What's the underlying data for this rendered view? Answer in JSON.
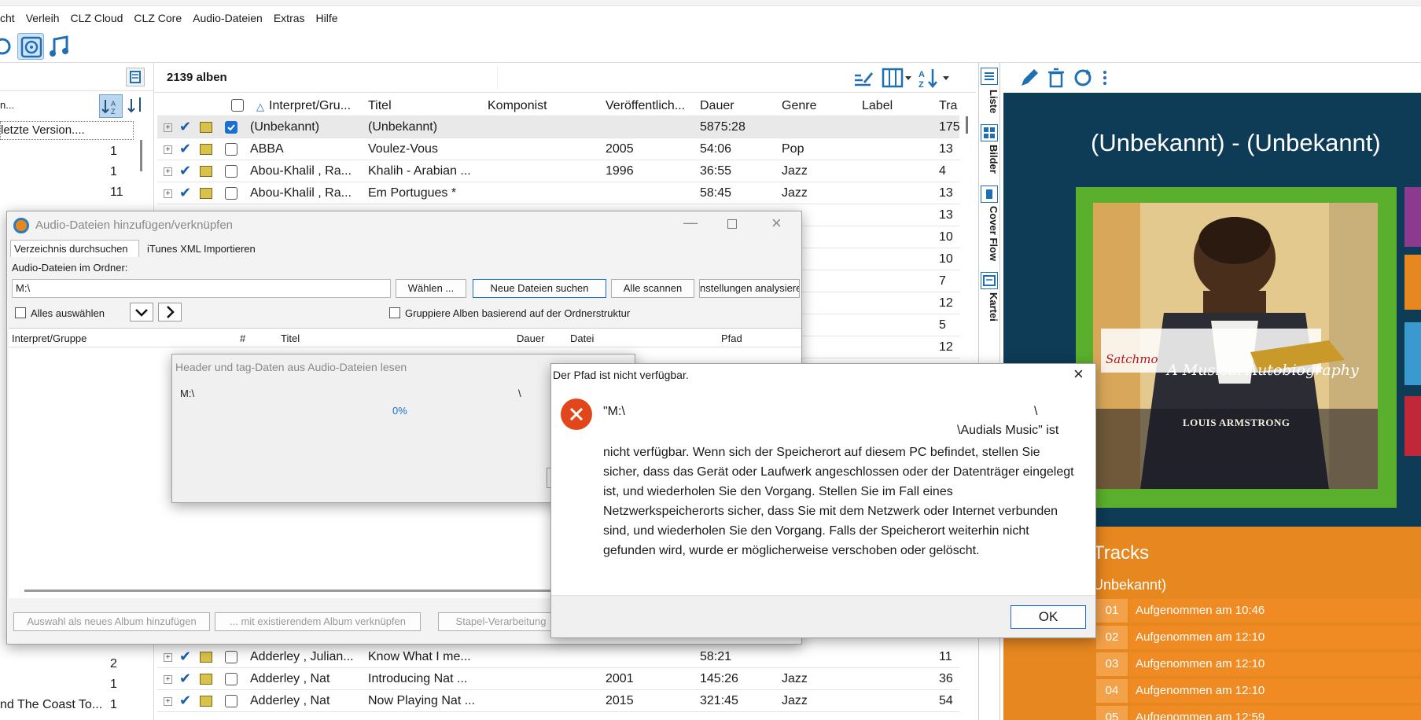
{
  "menu": [
    "cht",
    "Verleih",
    "CLZ Cloud",
    "CLZ Core",
    "Audio-Dateien",
    "Extras",
    "Hilfe"
  ],
  "main": {
    "album_count": "2139 alben"
  },
  "left": {
    "search_partial": "n...",
    "version_item": " letzte Version....",
    "counts_top": [
      "1",
      "1",
      "11"
    ],
    "counts_bottom": [
      "2",
      "1",
      "1"
    ],
    "bottom_label": "nd The Coast To..."
  },
  "grid": {
    "headers": [
      "Interpret/Gru...",
      "Titel",
      "Komponist",
      "Veröffentlich...",
      "Dauer",
      "Genre",
      "Label",
      "Tra"
    ],
    "rows_top": [
      {
        "artist": "(Unbekannt)",
        "title": "(Unbekannt)",
        "year": "",
        "duration": "5875:28",
        "genre": "",
        "tracks": "175",
        "checked": true
      },
      {
        "artist": "ABBA",
        "title": "Voulez-Vous",
        "year": "2005",
        "duration": "54:06",
        "genre": "Pop",
        "tracks": "13",
        "checked": false
      },
      {
        "artist": "Abou-Khalil ,  Ra...",
        "title": "Khalih - Arabian ...",
        "year": "1996",
        "duration": "36:55",
        "genre": "Jazz",
        "tracks": "4",
        "checked": false
      },
      {
        "artist": "Abou-Khalil ,  Ra...",
        "title": "Em Portugues   *",
        "year": "",
        "duration": "58:45",
        "genre": "Jazz",
        "tracks": "13",
        "checked": false
      }
    ],
    "partial_genres": [
      "z",
      "z",
      "z",
      "z",
      "z",
      "z",
      "z"
    ],
    "partial_tracks": [
      "13",
      "10",
      "10",
      "7",
      "12",
      "5",
      "12"
    ],
    "rows_bottom": [
      {
        "artist": "Adderley ,  Julian...",
        "title": "Know What I me...",
        "year": "",
        "duration": "58:21",
        "genre": "",
        "tracks": "11"
      },
      {
        "artist": "Adderley ,  Nat",
        "title": "Introducing Nat ...",
        "year": "2001",
        "duration": "145:26",
        "genre": "Jazz",
        "tracks": "36"
      },
      {
        "artist": "Adderley ,  Nat",
        "title": "Now Playing Nat ...",
        "year": "2015",
        "duration": "321:45",
        "genre": "Jazz",
        "tracks": "54"
      }
    ]
  },
  "vtabs": [
    "Liste",
    "Bilder",
    "Cover Flow",
    "Kartei"
  ],
  "detail": {
    "heading": "(Unbekannt) - (Unbekannt)",
    "cover_name": "LOUIS ARMSTRONG",
    "cover_signature": "Satchmo",
    "cover_script": "A Musical Autobiography",
    "tracks_heading": "Tracks",
    "tracks_sub": "Unbekannt)",
    "tracks": [
      {
        "num": "01",
        "title": "Aufgenommen am 10:46"
      },
      {
        "num": "02",
        "title": "Aufgenommen am 12:10"
      },
      {
        "num": "03",
        "title": "Aufgenommen am 12:10"
      },
      {
        "num": "04",
        "title": "Aufgenommen am 12:10"
      },
      {
        "num": "05",
        "title": "Aufgenommen am 12:59"
      }
    ]
  },
  "audio_dialog": {
    "title": "Audio-Dateien hinzufügen/verknüpfen",
    "tab1": "Verzeichnis durchsuchen",
    "tab2": "iTunes XML Importieren",
    "folder_label": "Audio-Dateien im Ordner:",
    "folder_value": "M:\\",
    "btn_choose": "Wählen ...",
    "btn_new": "Neue Dateien suchen",
    "btn_scan": "Alle scannen",
    "btn_settings": "nstellungen analysiere",
    "select_all": "Alles auswählen",
    "group_by_folder": "Gruppiere Alben basierend auf der Ordnerstruktur",
    "columns": [
      "Interpret/Gruppe",
      "#",
      "Titel",
      "Dauer",
      "Datei",
      "Pfad"
    ],
    "btn_add_new": "Auswahl als neues Album hinzufügen",
    "btn_link": "... mit existierendem Album verknüpfen",
    "btn_batch": "Stapel-Verarbeitung"
  },
  "progress_dialog": {
    "title": "Header und tag-Daten aus Audio-Dateien lesen",
    "path": "M:\\",
    "path_sep": "\\",
    "percent": "0%",
    "value": 0.0
  },
  "error_dialog": {
    "title": "Der Pfad ist nicht verfügbar.",
    "line1_a": "\"M:\\",
    "line1_b": "\\",
    "line2": "\\Audials Music\" ist",
    "body": "nicht verfügbar. Wenn sich der Speicherort auf diesem PC befindet, stellen Sie sicher, dass das Gerät oder Laufwerk angeschlossen oder der Datenträger eingelegt ist, und wiederholen Sie den Vorgang. Stellen Sie im Fall eines Netzwerkspeicherorts sicher, dass Sie mit dem Netzwerk oder Internet verbunden sind, und wiederholen Sie den Vorgang. Falls der Speicherort weiterhin nicht gefunden wird, wurde er möglicherweise verschoben oder gelöscht.",
    "ok": "OK"
  },
  "colors": {
    "accent_blue": "#1a6fd1",
    "detail_bg": "#0e3b56",
    "tracks_orange": "#e6871f",
    "error_red": "#e2471b"
  }
}
